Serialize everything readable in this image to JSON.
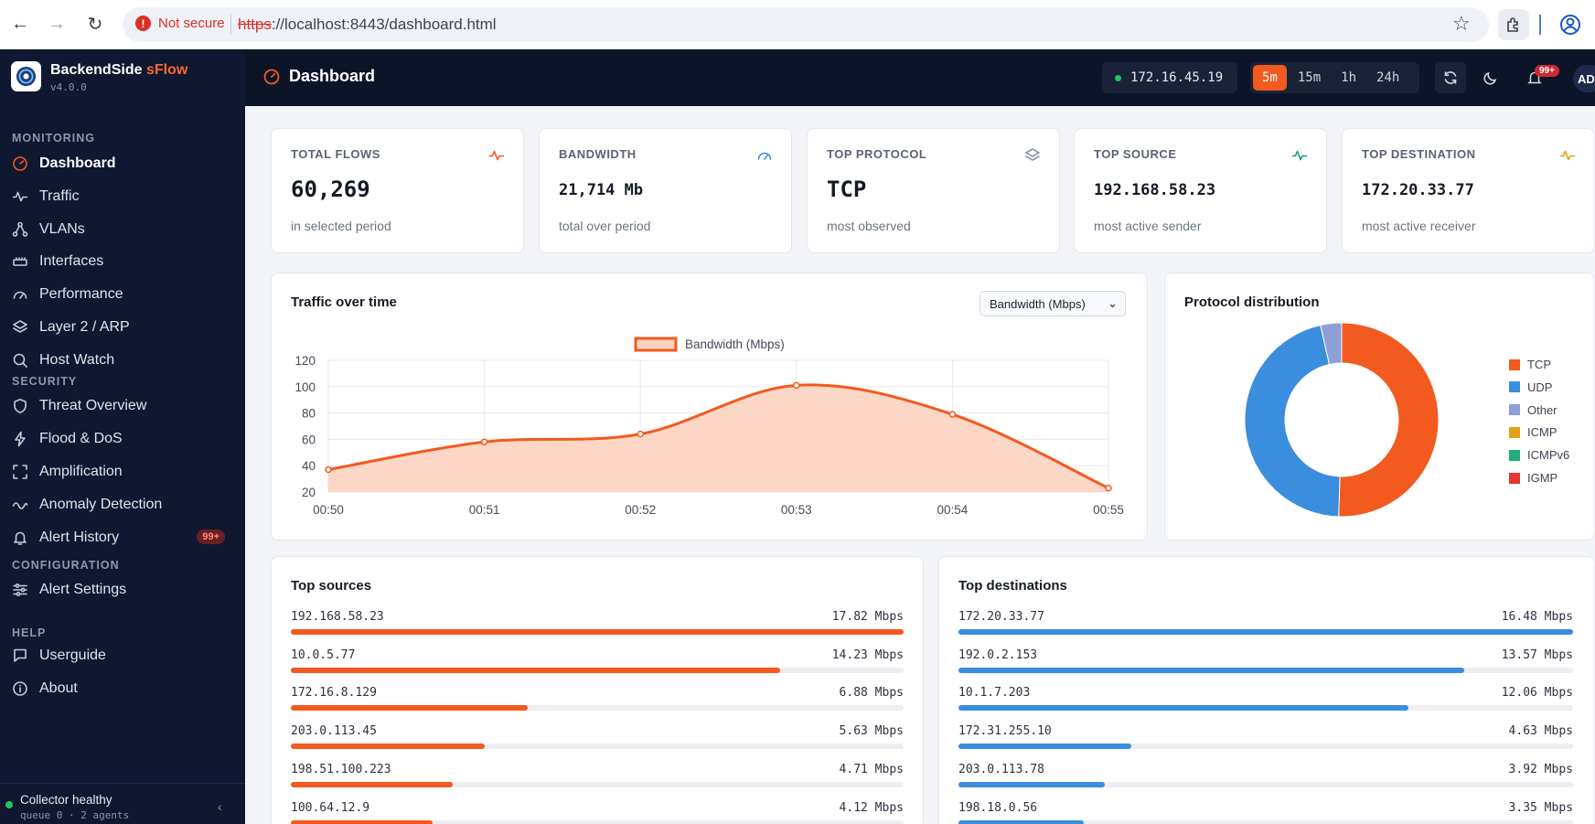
{
  "browser": {
    "security_label": "Not secure",
    "url_scheme": "https",
    "url_rest": "://localhost:8443/dashboard.html"
  },
  "brand": {
    "name_main": "BackendSide",
    "name_accent": "sFlow",
    "version": "v4.0.0"
  },
  "sidebar": {
    "sections": [
      {
        "label": "MONITORING",
        "items": [
          {
            "label": "Dashboard",
            "icon": "gauge-icon",
            "active": true
          },
          {
            "label": "Traffic",
            "icon": "activity-icon"
          },
          {
            "label": "VLANs",
            "icon": "network-icon"
          },
          {
            "label": "Interfaces",
            "icon": "ethernet-icon"
          },
          {
            "label": "Performance",
            "icon": "speedometer-icon"
          },
          {
            "label": "Layer 2 / ARP",
            "icon": "layers-icon"
          },
          {
            "label": "Host Watch",
            "icon": "search-icon"
          }
        ]
      },
      {
        "label": "SECURITY",
        "items": [
          {
            "label": "Threat Overview",
            "icon": "shield-icon"
          },
          {
            "label": "Flood & DoS",
            "icon": "bolt-icon"
          },
          {
            "label": "Amplification",
            "icon": "expand-icon"
          },
          {
            "label": "Anomaly Detection",
            "icon": "wave-icon"
          },
          {
            "label": "Alert History",
            "icon": "bell-icon",
            "badge": "99+"
          }
        ]
      },
      {
        "label": "CONFIGURATION",
        "items": [
          {
            "label": "Alert Settings",
            "icon": "sliders-icon"
          }
        ]
      },
      {
        "label": "HELP",
        "items": [
          {
            "label": "Userguide",
            "icon": "book-icon"
          },
          {
            "label": "About",
            "icon": "info-icon"
          }
        ]
      }
    ],
    "collector_title": "Collector healthy",
    "collector_sub": "queue 0 · 2 agents"
  },
  "topbar": {
    "title": "Dashboard",
    "agent_ip": "172.16.45.19",
    "ranges": [
      "5m",
      "15m",
      "1h",
      "24h"
    ],
    "active_range": "5m",
    "notification_badge": "99+",
    "avatar_initials": "AD"
  },
  "stats": [
    {
      "label": "TOTAL FLOWS",
      "value": "60,269",
      "sub": "in selected period",
      "icon": "activity-icon",
      "color": "#f25a1f"
    },
    {
      "label": "BANDWIDTH",
      "value": "21,714 Mb",
      "sub": "total over period",
      "icon": "speedometer-icon",
      "color": "#3b8ddd"
    },
    {
      "label": "TOP PROTOCOL",
      "value": "TCP",
      "sub": "most observed",
      "icon": "layers-icon",
      "color": "#8a93a8"
    },
    {
      "label": "TOP SOURCE",
      "value": "192.168.58.23",
      "sub": "most active sender",
      "icon": "activity-icon",
      "color": "#16a37a"
    },
    {
      "label": "TOP DESTINATION",
      "value": "172.20.33.77",
      "sub": "most active receiver",
      "icon": "activity-icon",
      "color": "#e6a01a"
    }
  ],
  "traffic": {
    "title": "Traffic over time",
    "select_value": "Bandwidth (Mbps)"
  },
  "protocol": {
    "title": "Protocol distribution"
  },
  "chart_data": [
    {
      "type": "area",
      "x": [
        "00:50",
        "00:51",
        "00:52",
        "00:53",
        "00:54",
        "00:55"
      ],
      "series": [
        {
          "name": "Bandwidth (Mbps)",
          "values": [
            37,
            58,
            64,
            101,
            79,
            23
          ],
          "color": "#f25a1f"
        }
      ],
      "ylim": [
        20,
        120
      ],
      "yticks": [
        20,
        40,
        60,
        80,
        100,
        120
      ],
      "grid": true,
      "legend": "top"
    },
    {
      "type": "pie",
      "categories": [
        "TCP",
        "UDP",
        "Other",
        "ICMP",
        "ICMPv6",
        "IGMP"
      ],
      "values": [
        50.5,
        46.0,
        3.5,
        0,
        0,
        0
      ],
      "colors": [
        "#f25a1f",
        "#3b8ddd",
        "#8e9fd6",
        "#e6a01a",
        "#1fb07a",
        "#e0382e"
      ],
      "legend": "right"
    }
  ],
  "top_sources": {
    "title": "Top sources",
    "color": "#f25a1f",
    "max": 17.82,
    "rows": [
      {
        "ip": "192.168.58.23",
        "value": 17.82,
        "label": "17.82 Mbps"
      },
      {
        "ip": "10.0.5.77",
        "value": 14.23,
        "label": "14.23 Mbps"
      },
      {
        "ip": "172.16.8.129",
        "value": 6.88,
        "label": "6.88 Mbps"
      },
      {
        "ip": "203.0.113.45",
        "value": 5.63,
        "label": "5.63 Mbps"
      },
      {
        "ip": "198.51.100.223",
        "value": 4.71,
        "label": "4.71 Mbps"
      },
      {
        "ip": "100.64.12.9",
        "value": 4.12,
        "label": "4.12 Mbps"
      }
    ]
  },
  "top_destinations": {
    "title": "Top destinations",
    "color": "#3b8ddd",
    "max": 16.48,
    "rows": [
      {
        "ip": "172.20.33.77",
        "value": 16.48,
        "label": "16.48 Mbps"
      },
      {
        "ip": "192.0.2.153",
        "value": 13.57,
        "label": "13.57 Mbps"
      },
      {
        "ip": "10.1.7.203",
        "value": 12.06,
        "label": "12.06 Mbps"
      },
      {
        "ip": "172.31.255.10",
        "value": 4.63,
        "label": "4.63 Mbps"
      },
      {
        "ip": "203.0.113.78",
        "value": 3.92,
        "label": "3.92 Mbps"
      },
      {
        "ip": "198.18.0.56",
        "value": 3.35,
        "label": "3.35 Mbps"
      }
    ]
  }
}
